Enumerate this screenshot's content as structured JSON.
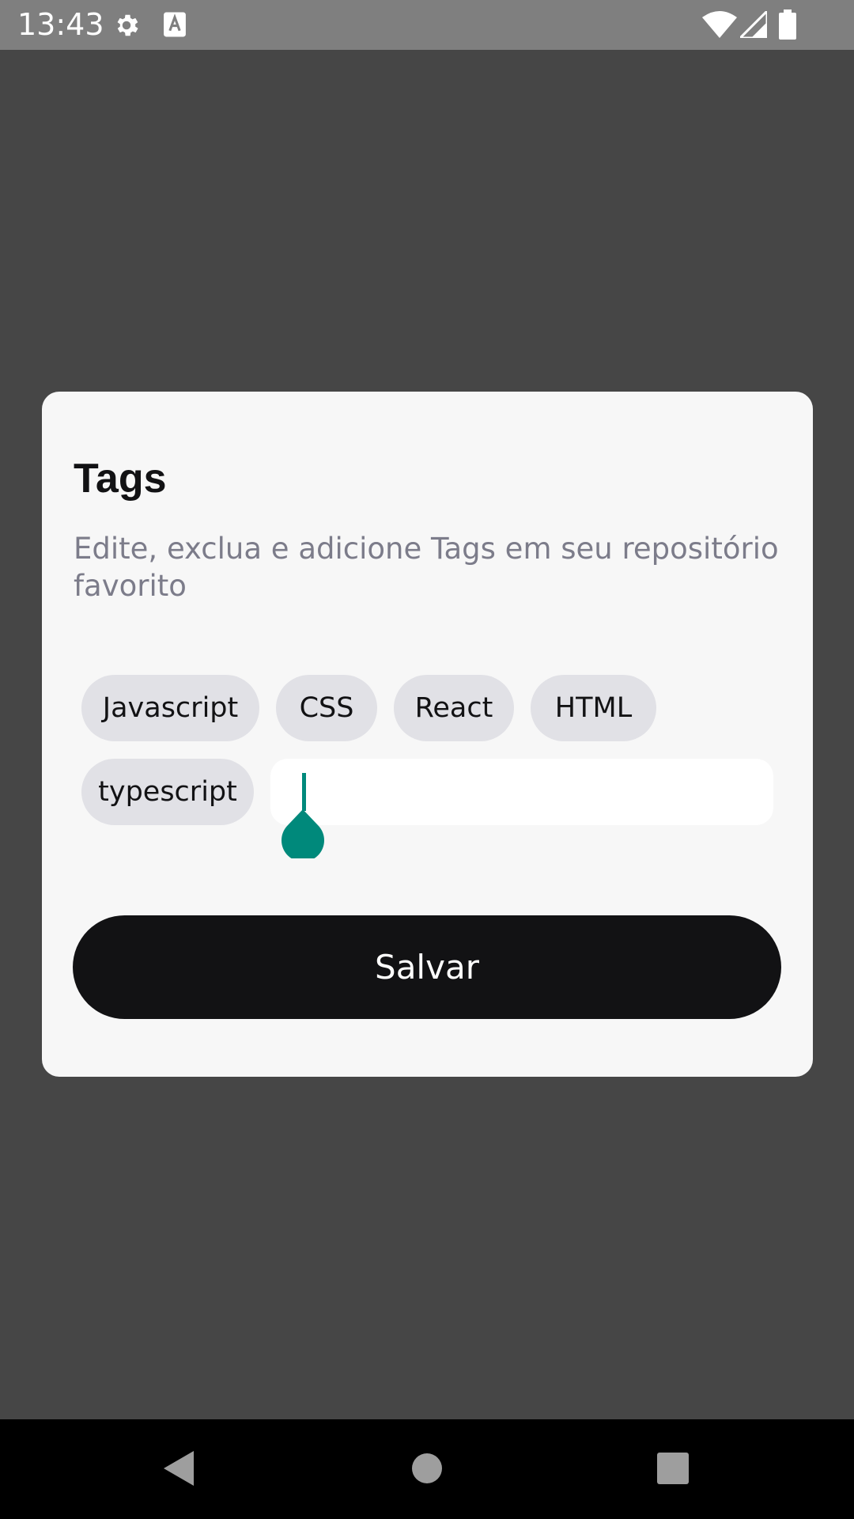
{
  "status_bar": {
    "time": "13:43",
    "icons": [
      "gear-icon",
      "text-format-icon",
      "wifi-icon",
      "cellular-signal-icon",
      "battery-icon"
    ]
  },
  "dialog": {
    "title": "Tags",
    "description": "Edite, exclua e adicione Tags em seu repositório favorito",
    "tags": [
      "Javascript",
      "CSS",
      "React",
      "HTML",
      "typescript"
    ],
    "new_tag_input": {
      "value": "",
      "placeholder": ""
    },
    "save_label": "Salvar"
  },
  "colors": {
    "accent": "#00897b",
    "button": "#121214",
    "chip": "#e1e1e6",
    "dialog_bg": "#f7f7f7"
  },
  "nav_bar": {
    "icons": [
      "back-icon",
      "home-icon",
      "recents-icon"
    ]
  }
}
